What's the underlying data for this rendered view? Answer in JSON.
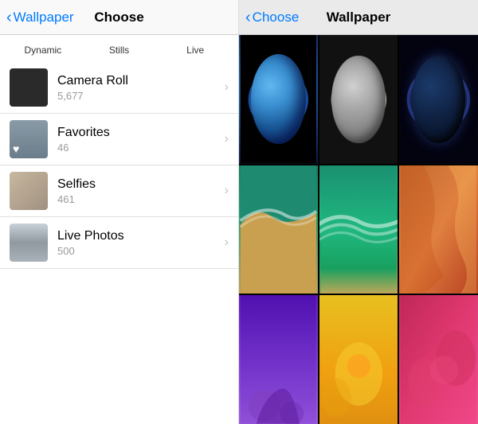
{
  "left": {
    "nav": {
      "back_label": "Wallpaper",
      "title": "Choose"
    },
    "categories": [
      {
        "id": "dynamic",
        "label": "Dynamic"
      },
      {
        "id": "stills",
        "label": "Stills"
      },
      {
        "id": "live",
        "label": "Live"
      }
    ],
    "list_items": [
      {
        "id": "camera-roll",
        "name": "Camera Roll",
        "count": "5,677"
      },
      {
        "id": "favorites",
        "name": "Favorites",
        "count": "46"
      },
      {
        "id": "selfies",
        "name": "Selfies",
        "count": "461"
      },
      {
        "id": "live-photos",
        "name": "Live Photos",
        "count": "500"
      }
    ]
  },
  "right": {
    "nav": {
      "back_label": "Choose",
      "title": "Wallpaper"
    }
  },
  "colors": {
    "accent": "#007aff"
  }
}
